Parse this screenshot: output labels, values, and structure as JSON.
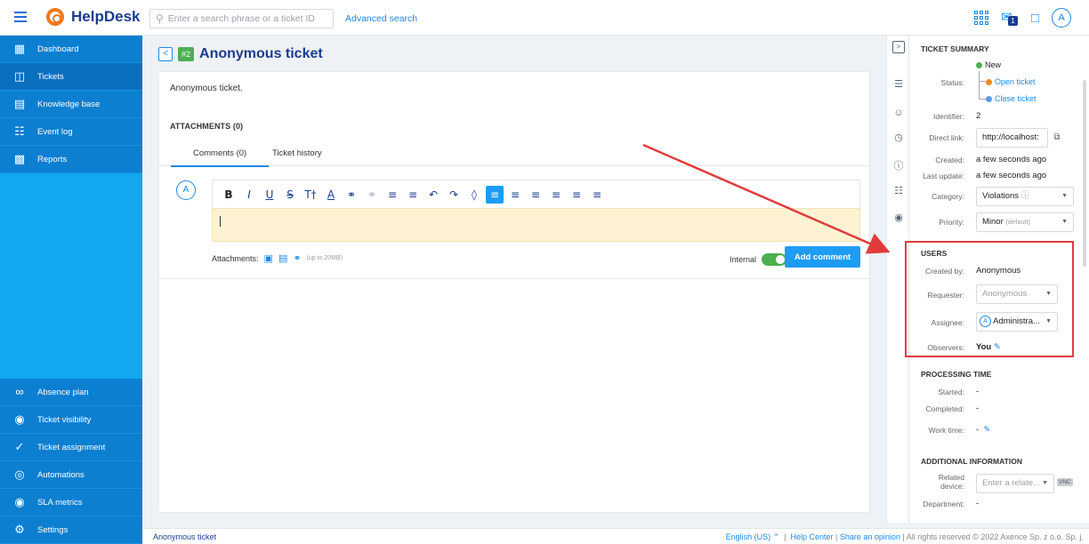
{
  "topbar": {
    "brand": "HelpDesk",
    "search_placeholder": "Enter a search phrase or a ticket ID",
    "advanced_search": "Advanced search",
    "notification_count": "1",
    "user_initial": "A"
  },
  "sidebar": {
    "items": [
      {
        "label": "Dashboard",
        "icon": "dashboard-icon"
      },
      {
        "label": "Tickets",
        "icon": "tickets-icon"
      },
      {
        "label": "Knowledge base",
        "icon": "book-icon"
      },
      {
        "label": "Event log",
        "icon": "event-log-icon"
      },
      {
        "label": "Reports",
        "icon": "reports-icon"
      }
    ],
    "bottom_items": [
      {
        "label": "Absence plan",
        "icon": "absence-icon"
      },
      {
        "label": "Ticket visibility",
        "icon": "visibility-icon"
      },
      {
        "label": "Ticket assignment",
        "icon": "assignment-icon"
      },
      {
        "label": "Automations",
        "icon": "automations-icon"
      },
      {
        "label": "SLA metrics",
        "icon": "sla-icon"
      },
      {
        "label": "Settings",
        "icon": "settings-icon"
      }
    ]
  },
  "ticket": {
    "number": "#2",
    "title": "Anonymous ticket",
    "description": "Anonymous ticket.",
    "attachments_header": "ATTACHMENTS (0)",
    "tabs": [
      "Comments (0)",
      "Ticket history"
    ],
    "comment_avatar": "A",
    "attachments_label": "Attachments:",
    "attachments_limit": "(up to 20MB)",
    "internal_label": "Internal",
    "internal_on": true,
    "add_comment": "Add comment"
  },
  "summary": {
    "header": "TICKET SUMMARY",
    "status_label": "Status:",
    "status_current": "New",
    "status_options": [
      "Open ticket",
      "Close ticket"
    ],
    "identifier_label": "Identifier:",
    "identifier": "2",
    "direct_link_label": "Direct link:",
    "direct_link": "http://localhost:",
    "created_label": "Created:",
    "created": "a few seconds ago",
    "last_update_label": "Last update:",
    "last_update": "a few seconds ago",
    "category_label": "Category:",
    "category": "Violations",
    "priority_label": "Priority:",
    "priority": "Minor",
    "priority_note": "(default)"
  },
  "users": {
    "header": "USERS",
    "created_by_label": "Created by:",
    "created_by": "Anonymous",
    "requester_label": "Requester:",
    "requester_placeholder": "Anonymous",
    "assignee_label": "Assignee:",
    "assignee_initial": "A",
    "assignee": "Administra...",
    "observers_label": "Observers:",
    "observers": "You"
  },
  "processing": {
    "header": "PROCESSING TIME",
    "started_label": "Started:",
    "started": "-",
    "completed_label": "Completed:",
    "completed": "-",
    "work_time_label": "Work time:",
    "work_time": "-"
  },
  "additional": {
    "header": "ADDITIONAL INFORMATION",
    "related_device_label_1": "Related",
    "related_device_label_2": "device:",
    "related_device_placeholder": "Enter a relate...",
    "vnc": "VNC",
    "department_label": "Department:",
    "department": "-"
  },
  "footer": {
    "left": "Anonymous ticket",
    "language": "English (US)",
    "help_center": "Help Center",
    "share_opinion": "Share an opinion",
    "rights": "All rights reserved © 2022 Axence Sp. z o.o. Sp. j."
  },
  "colors": {
    "accent": "#1e88e5",
    "sidebar": "#13a7f0",
    "highlight_box": "#e03c3c",
    "status_new": "#4caf50",
    "status_open": "#ef8a1a",
    "status_close": "#5c9ce6"
  }
}
